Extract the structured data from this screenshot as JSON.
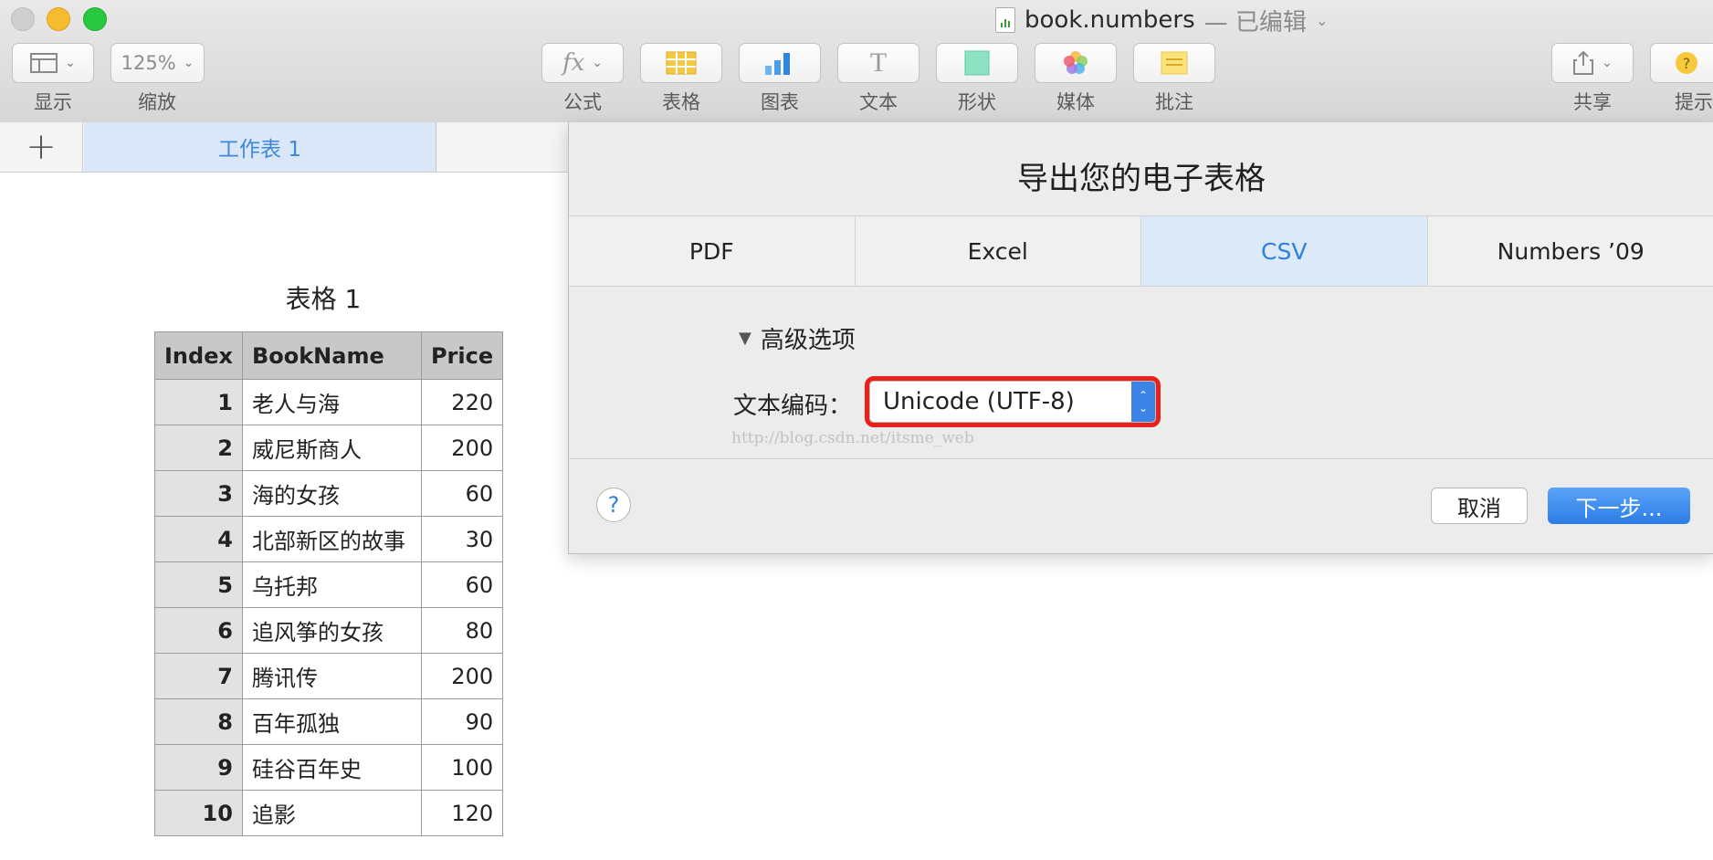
{
  "window": {
    "title": "book.numbers",
    "subtitle": "— 已编辑"
  },
  "toolbar": {
    "view_label": "显示",
    "zoom_value": "125%",
    "zoom_label": "缩放",
    "formula_icon_text": "fx",
    "formula_label": "公式",
    "table_label": "表格",
    "chart_label": "图表",
    "text_icon_text": "T",
    "text_label": "文本",
    "shape_label": "形状",
    "media_label": "媒体",
    "comment_label": "批注",
    "share_label": "共享",
    "tips_label": "提示"
  },
  "tabs": {
    "active_sheet": "工作表 1"
  },
  "sheet_table": {
    "title": "表格 1",
    "headers": [
      "Index",
      "BookName",
      "Price"
    ],
    "rows": [
      [
        "1",
        "老人与海",
        "220"
      ],
      [
        "2",
        "威尼斯商人",
        "200"
      ],
      [
        "3",
        "海的女孩",
        "60"
      ],
      [
        "4",
        "北部新区的故事",
        "30"
      ],
      [
        "5",
        "乌托邦",
        "60"
      ],
      [
        "6",
        "追风筝的女孩",
        "80"
      ],
      [
        "7",
        "腾讯传",
        "200"
      ],
      [
        "8",
        "百年孤独",
        "90"
      ],
      [
        "9",
        "硅谷百年史",
        "100"
      ],
      [
        "10",
        "追影",
        "120"
      ]
    ]
  },
  "dialog": {
    "title": "导出您的电子表格",
    "format_tabs": [
      "PDF",
      "Excel",
      "CSV",
      "Numbers ’09"
    ],
    "active_format": "CSV",
    "advanced_label": "高级选项",
    "encoding_label": "文本编码：",
    "encoding_value": "Unicode (UTF-8)",
    "watermark": "http://blog.csdn.net/itsme_web",
    "help_text": "?",
    "cancel_label": "取消",
    "next_label": "下一步..."
  },
  "colors": {
    "accent_blue": "#2f7fdc",
    "highlight_red": "#e8221b",
    "active_tab_bg": "#dce9f8"
  }
}
